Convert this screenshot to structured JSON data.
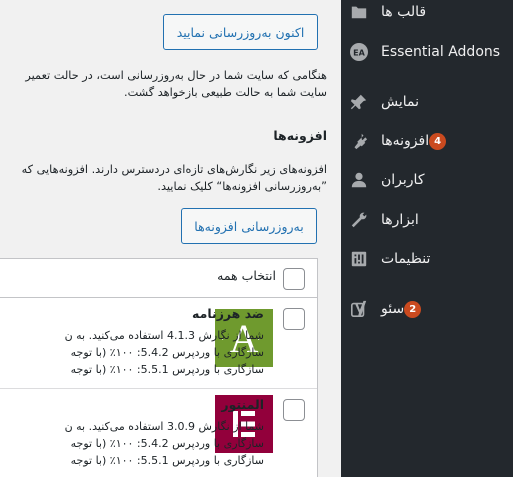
{
  "sidebar": {
    "items": [
      {
        "label": "قالب ها",
        "icon": "brush-icon"
      },
      {
        "label": "Essential Addons",
        "icon": "essential-addons-icon"
      },
      {
        "label": "نمایش",
        "icon": "pin-icon"
      },
      {
        "label": "افزونه‌ها",
        "icon": "plugin-icon",
        "badge": "4"
      },
      {
        "label": "کاربران",
        "icon": "user-icon"
      },
      {
        "label": "ابزارها",
        "icon": "wrench-icon"
      },
      {
        "label": "تنظیمات",
        "icon": "settings-sliders-icon"
      },
      {
        "label": "سئو",
        "icon": "yoast-icon",
        "badge": "2"
      }
    ]
  },
  "main": {
    "update_now_button": "اکنون به‌روزرسانی نمایید",
    "maintenance_text_line1": "هنگامی که سایت شما در حال به‌روزرسانی است، در حالت تعمیر",
    "maintenance_text_line2": "سایت شما به حالت طبیعی بازخواهد گشت.",
    "plugins_heading": "افزونه‌ها",
    "plugins_text_line1": "افزونه‌های زیر نگارش‌های تازه‌ای دردسترس دارند. افزونه‌هایی که",
    "plugins_text_line2": "”به‌روزرسانی افزونه‌ها“ کلیک نمایید.",
    "update_plugins_button": "به‌روزرسانی افزونه‌ها",
    "select_all_label": "انتخاب همه",
    "plugins": [
      {
        "name": "ضد هرزنامه",
        "line1": "شما از نگارش 4.1.3 استفاده می‌کنید. به ن",
        "line2": "سازگاری با وردپرس 5.4.2: ۱۰۰٪ (با توجه",
        "line3": "سازگاری با وردپرس 5.5.1: ۱۰۰٪ (با توجه",
        "icon_letter": "A",
        "icon_color": "#6f9a2e"
      },
      {
        "name": "المنتور",
        "line1": "شما از نگارش 3.0.9 استفاده می‌کنید. به ن",
        "line2": "سازگاری با وردپرس 5.4.2: ۱۰۰٪ (با توجه",
        "line3": "سازگاری با وردپرس 5.5.1: ۱۰۰٪ (با توجه",
        "icon_letter": "E",
        "icon_color": "#92003b"
      }
    ]
  }
}
